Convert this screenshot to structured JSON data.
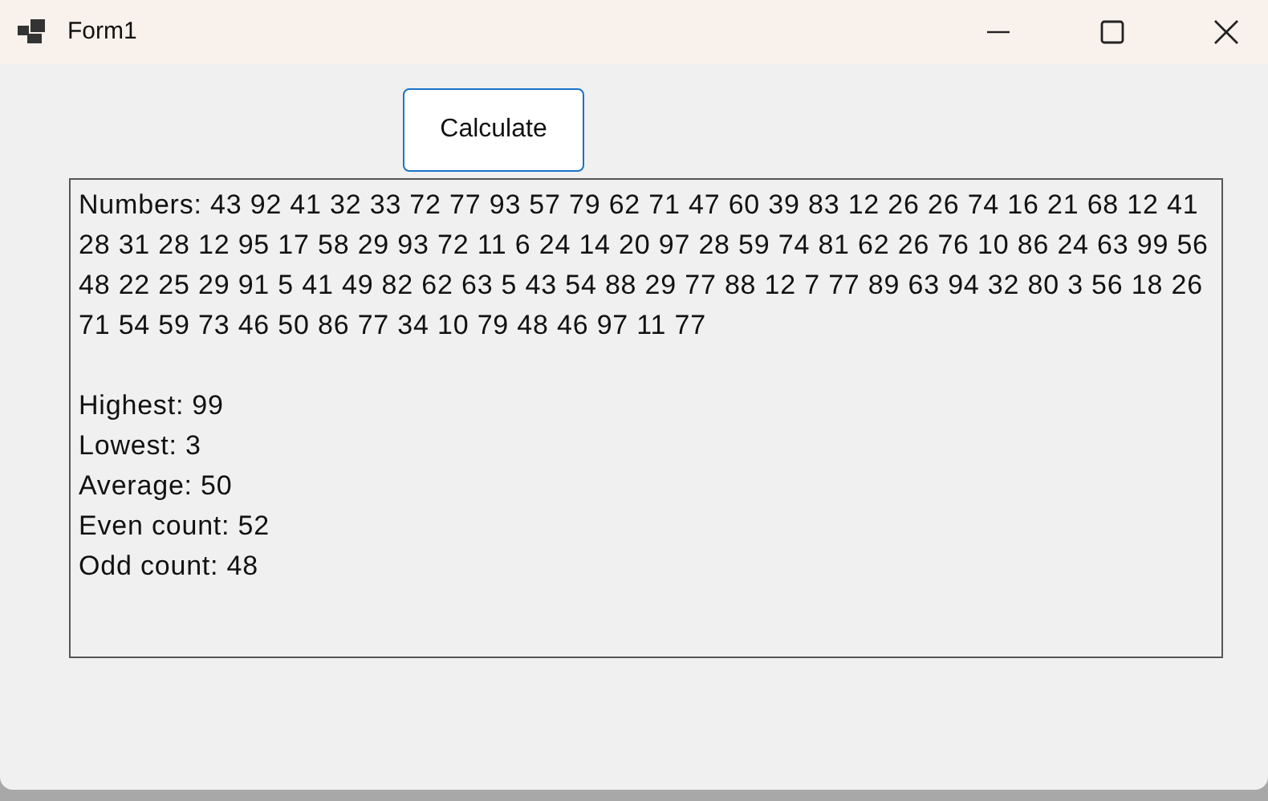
{
  "window": {
    "title": "Form1"
  },
  "calculate_button": {
    "label": "Calculate"
  },
  "output": {
    "numbers": "Numbers: 43 92 41 32 33 72 77 93 57 79 62 71 47 60 39 83 12 26 26 74 16 21 68 12 41 28 31 28 12 95 17 58 29 93 72 11 6 24 14 20 97 28 59 74 81 62 26 76 10 86 24 63 99 56 48 22 25 29 91 5 41 49 82 62 63 5 43 54 88 29 77 88 12 7 77 89 63 94 32 80 3 56 18 26 71 54 59 73 46 50 86 77 34 10 79 48 46 97 11 77",
    "results": [
      "Highest: 99",
      "Lowest: 3",
      "Average: 50",
      "Even count: 52",
      "Odd count: 48"
    ]
  }
}
